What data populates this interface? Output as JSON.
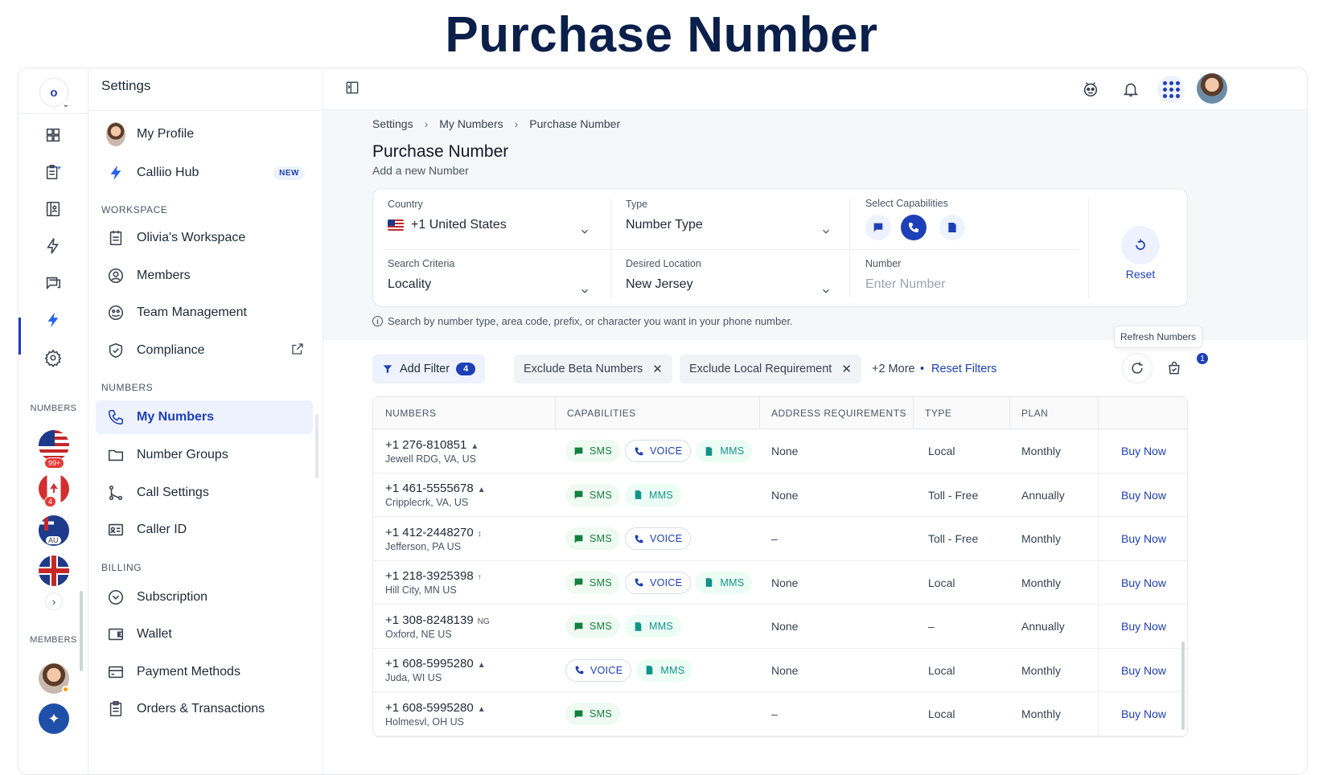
{
  "banner": {
    "title": "Purchase Number"
  },
  "rail": {
    "logo": "o",
    "icons": [
      "dashboard-icon",
      "tasks-sparkle-icon",
      "contacts-icon",
      "bolt-icon",
      "chat-icon",
      "calliio-hub-icon",
      "settings-icon"
    ],
    "numbers_label": "NUMBERS",
    "flags": [
      {
        "country": "US",
        "badge": "99+"
      },
      {
        "country": "CA",
        "badge": "4"
      },
      {
        "country": "AU",
        "badge": "AU"
      },
      {
        "country": "UK",
        "badge": ""
      }
    ],
    "expand": "›",
    "members_label": "MEMBERS"
  },
  "sidebar": {
    "title": "Settings",
    "items": [
      {
        "label": "My Profile"
      },
      {
        "label": "Calliio Hub",
        "badge": "NEW"
      }
    ],
    "workspace_label": "WORKSPACE",
    "workspace": [
      {
        "label": "Olivia's Workspace"
      },
      {
        "label": "Members"
      },
      {
        "label": "Team Management"
      },
      {
        "label": "Compliance"
      }
    ],
    "numbers_label": "NUMBERS",
    "numbers": [
      {
        "label": "My Numbers"
      },
      {
        "label": "Number Groups"
      },
      {
        "label": "Call Settings"
      },
      {
        "label": "Caller ID"
      }
    ],
    "billing_label": "BILLING",
    "billing": [
      {
        "label": "Subscription"
      },
      {
        "label": "Wallet"
      },
      {
        "label": "Payment Methods"
      },
      {
        "label": "Orders & Transactions"
      }
    ]
  },
  "breadcrumb": [
    "Settings",
    "My Numbers",
    "Purchase Number"
  ],
  "page": {
    "title": "Purchase Number",
    "subtitle": "Add a new Number"
  },
  "form": {
    "country": {
      "label": "Country",
      "value": "+1 United States"
    },
    "type": {
      "label": "Type",
      "value": "Number Type"
    },
    "capabilities": {
      "label": "Select Capabilities"
    },
    "search_criteria": {
      "label": "Search Criteria",
      "value": "Locality"
    },
    "desired_location": {
      "label": "Desired Location",
      "value": "New Jersey"
    },
    "number": {
      "label": "Number",
      "placeholder": "Enter Number"
    },
    "reset": "Reset"
  },
  "hint": "Search by number type, area code, prefix, or character you want in your phone number.",
  "tooltip": "Refresh Numbers",
  "filters": {
    "add_filter": "Add Filter",
    "add_filter_count": "4",
    "chips": [
      "Exclude Beta Numbers",
      "Exclude Local Requirement"
    ],
    "more": "+2 More",
    "dot": "•",
    "reset": "Reset Filters",
    "cart_count": "1"
  },
  "table": {
    "headers": [
      "NUMBERS",
      "CAPABILITIES",
      "ADDRESS REQUIREMENTS",
      "TYPE",
      "PLAN"
    ],
    "rows": [
      {
        "number": "+1 276-810851",
        "mark": "▲",
        "location": "Jewell RDG, VA, US",
        "caps": [
          "SMS",
          "VOICE",
          "MMS"
        ],
        "address": "None",
        "type": "Local",
        "plan": "Monthly",
        "action": "Buy Now"
      },
      {
        "number": "+1 461-5555678",
        "mark": "▲",
        "location": "Cripplecrk, VA, US",
        "caps": [
          "SMS",
          "MMS"
        ],
        "address": "None",
        "type": "Toll - Free",
        "plan": "Annually",
        "action": "Buy Now"
      },
      {
        "number": "+1 412-2448270",
        "mark": "↕",
        "location": "Jefferson, PA US",
        "caps": [
          "SMS",
          "VOICE"
        ],
        "address": "–",
        "type": "Toll - Free",
        "plan": "Monthly",
        "action": "Buy Now"
      },
      {
        "number": "+1 218-3925398",
        "mark": "↑",
        "location": "Hill City, MN US",
        "caps": [
          "SMS",
          "VOICE",
          "MMS"
        ],
        "address": "None",
        "type": "Local",
        "plan": "Monthly",
        "action": "Buy Now"
      },
      {
        "number": "+1 308-8248139",
        "mark": "NG",
        "location": "Oxford, NE US",
        "caps": [
          "SMS",
          "MMS"
        ],
        "address": "None",
        "type": "–",
        "plan": "Annually",
        "action": "Buy Now"
      },
      {
        "number": "+1 608-5995280",
        "mark": "▲",
        "location": "Juda, WI US",
        "caps": [
          "VOICE",
          "MMS"
        ],
        "address": "None",
        "type": "Local",
        "plan": "Monthly",
        "action": "Buy Now"
      },
      {
        "number": "+1 608-5995280",
        "mark": "▲",
        "location": "Holmesvl, OH US",
        "caps": [
          "SMS"
        ],
        "address": "–",
        "type": "Local",
        "plan": "Monthly",
        "action": "Buy Now"
      }
    ]
  },
  "colors": {
    "accent": "#1d3fb8",
    "sms": "#15803d",
    "mms": "#0f9488",
    "title": "#0b1f4b"
  }
}
